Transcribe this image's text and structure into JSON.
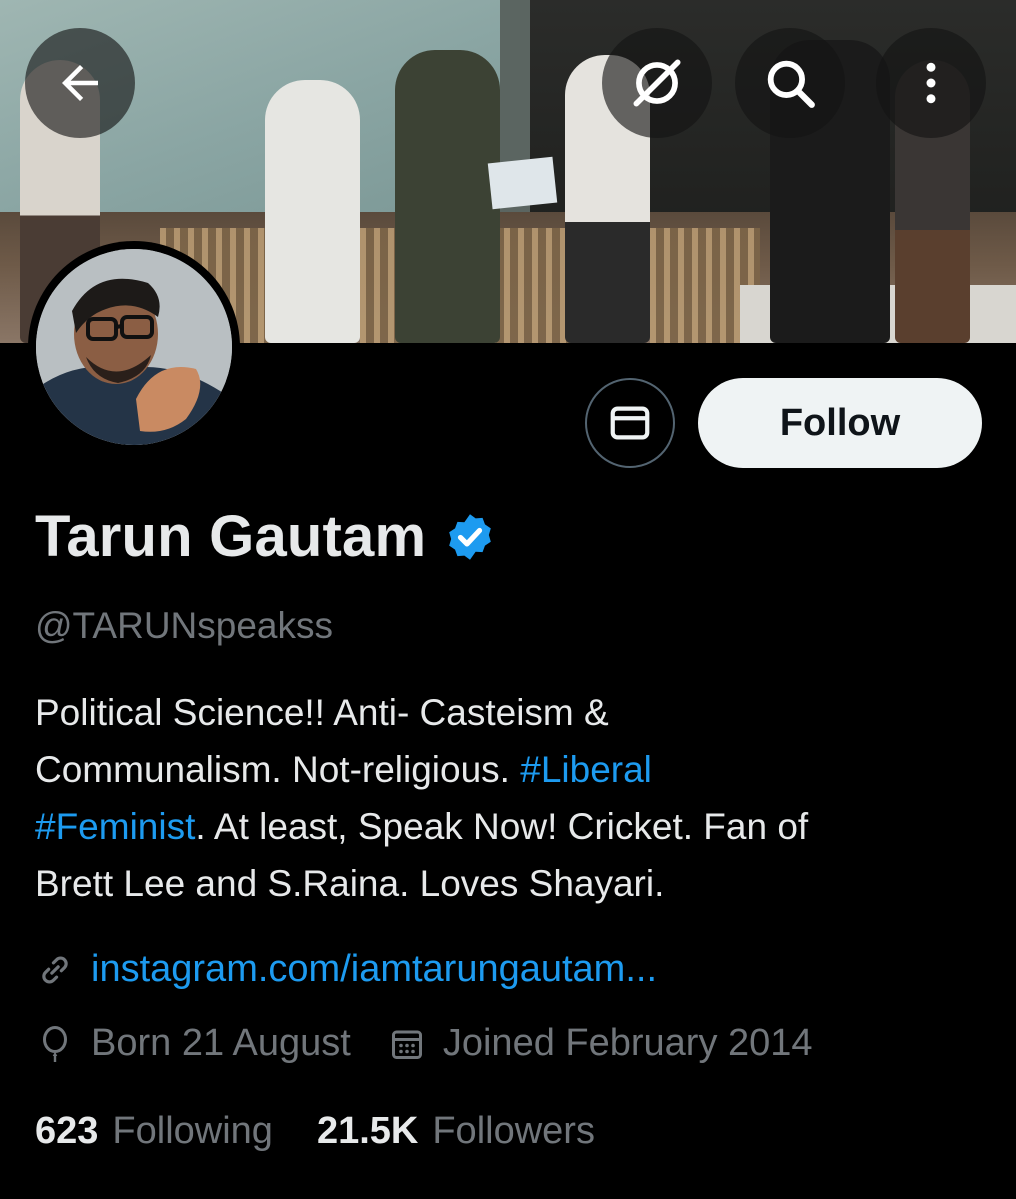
{
  "header": {
    "back_icon": "arrow-left-icon",
    "grok_icon": "grok-icon",
    "search_icon": "search-icon",
    "more_icon": "more-vertical-icon"
  },
  "profile": {
    "name": "Tarun Gautam",
    "verified": true,
    "handle": "@TARUNspeakss",
    "bio_parts": {
      "p1": "Political Science!! Anti- Casteism &",
      "p2": "Communalism. Not-religious. ",
      "tag1": "#Liberal",
      "tag2": "#Feminist",
      "p3": ". At least, Speak Now! Cricket. Fan of",
      "p4": "Brett Lee and S.Raina.  Loves Shayari."
    },
    "link": "instagram.com/iamtarungautam...",
    "born": "Born 21 August",
    "joined": "Joined February 2014"
  },
  "actions": {
    "follow_label": "Follow",
    "message_icon": "envelope-icon"
  },
  "stats": {
    "following_count": "623",
    "following_label": "Following",
    "followers_count": "21.5K",
    "followers_label": "Followers"
  },
  "colors": {
    "background": "#000000",
    "accent": "#1d9bf0",
    "secondary_text": "#71767b",
    "primary_text": "#e7e9ea"
  }
}
